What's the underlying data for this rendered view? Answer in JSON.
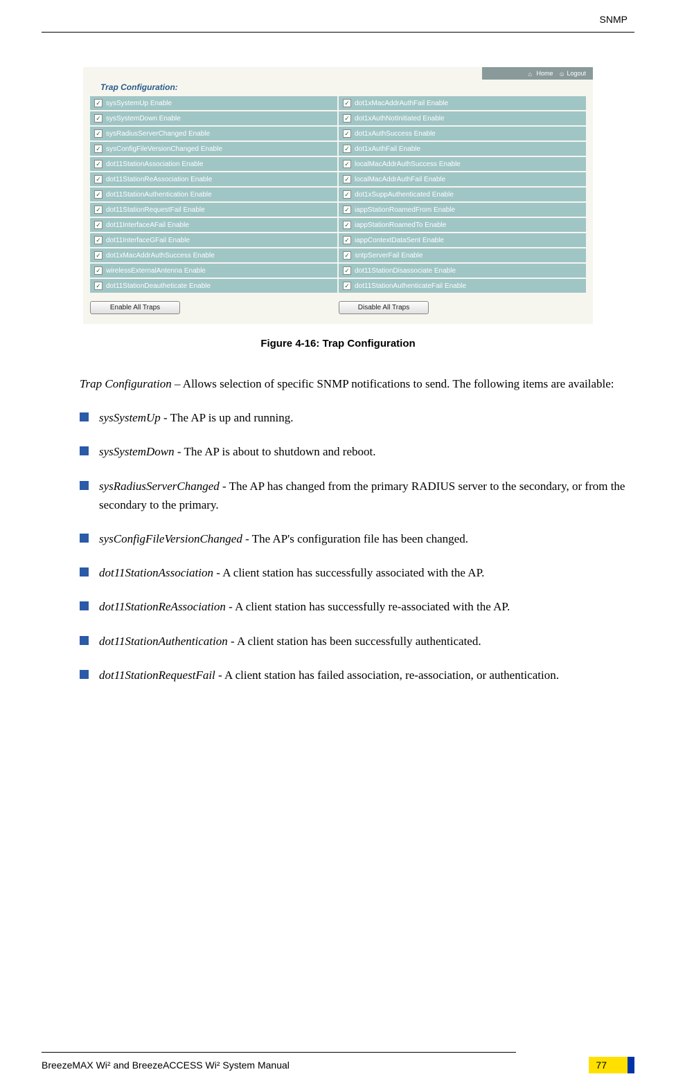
{
  "header": {
    "section": "SNMP"
  },
  "screenshot": {
    "title": "Trap Configuration:",
    "topbar": {
      "home": "Home",
      "logout": "Logout"
    },
    "left": [
      "sysSystemUp Enable",
      "sysSystemDown Enable",
      "sysRadiusServerChanged Enable",
      "sysConfigFileVersionChanged Enable",
      "dot11StationAssociation Enable",
      "dot11StationReAssociation Enable",
      "dot11StationAuthentication Enable",
      "dot11StationRequestFail Enable",
      "dot11InterfaceAFail Enable",
      "dot11InterfaceGFail Enable",
      "dot1xMacAddrAuthSuccess Enable",
      "wirelessExternalAntenna Enable",
      "dot11StationDeautheticate Enable"
    ],
    "right": [
      "dot1xMacAddrAuthFail Enable",
      "dot1xAuthNotInitiated Enable",
      "dot1xAuthSuccess Enable",
      "dot1xAuthFail Enable",
      "localMacAddrAuthSuccess Enable",
      "localMacAddrAuthFail Enable",
      "dot1xSuppAuthenticated Enable",
      "iappStationRoamedFrom Enable",
      "iappStationRoamedTo Enable",
      "iappContextDataSent Enable",
      "sntpServerFail Enable",
      "dot11StationDisassociate Enable",
      "dot11StationAuthenticateFail Enable"
    ],
    "buttons": {
      "enable": "Enable All Traps",
      "disable": "Disable All Traps"
    }
  },
  "figure_caption": "Figure 4-16: Trap Configuration",
  "intro": {
    "term": "Trap Configuration",
    "rest": " – Allows selection of specific SNMP notifications to send. The following items are available:"
  },
  "items": [
    {
      "term": "sysSystemUp",
      "desc": " - The AP is up and running."
    },
    {
      "term": "sysSystemDown",
      "desc": " - The AP is about to shutdown and reboot."
    },
    {
      "term": "sysRadiusServerChanged",
      "desc": " - The AP has changed from the primary RADIUS server to the secondary, or from the secondary to the primary."
    },
    {
      "term": "sysConfigFileVersionChanged",
      "desc": " - The AP's configuration file has been changed."
    },
    {
      "term": "dot11StationAssociation",
      "desc": " - A client station has successfully associated with the AP."
    },
    {
      "term": "dot11StationReAssociation",
      "desc": " - A client station has successfully re-associated with the AP."
    },
    {
      "term": "dot11StationAuthentication",
      "desc": " - A client station has been successfully authenticated."
    },
    {
      "term": "dot11StationRequestFail",
      "desc": " - A client station has failed association, re-association, or authentication."
    }
  ],
  "footer": {
    "manual": "BreezeMAX Wi² and BreezeACCESS Wi² System Manual",
    "page": "77"
  }
}
